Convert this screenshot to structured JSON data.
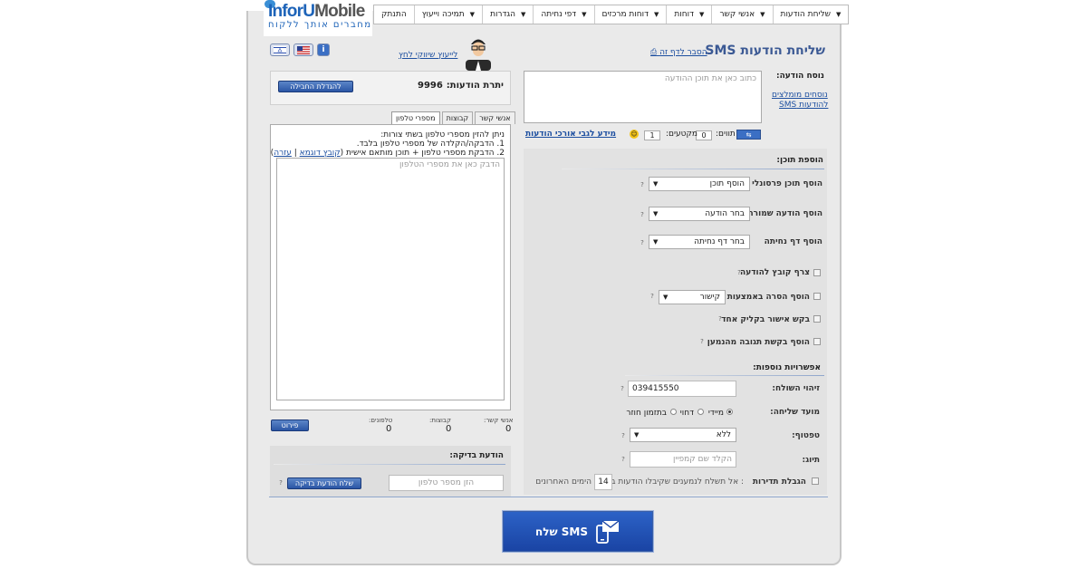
{
  "nav": [
    "שליחת הודעות",
    "אנשי קשר",
    "דוחות",
    "דוחות מרכזים",
    "דפי נחיתה",
    "הגדרות",
    "תמיכה וייעוץ",
    "התנתק"
  ],
  "logo": {
    "text_a": "InforU",
    "text_b": "Mobile",
    "tagline": "מחברים אותך ללקוח"
  },
  "header": {
    "title": "שליחת הודעות SMS",
    "help_link": "הסבר לדף זה",
    "consult_link": "לייעוץ שיווקי לחץ",
    "flag_info": "i"
  },
  "message": {
    "label": "נוסח הודעה:",
    "saved_link_1": "נוסחים מומלצים",
    "saved_link_2": "להודעות SMS",
    "placeholder": "כתוב כאן את תוכן ההודעה",
    "chars_label": "תווים:",
    "chars_value": "0",
    "segments_label": "מקטעים:",
    "segments_value": "1",
    "long_info_link": "מידע לגבי אורכי הודעות"
  },
  "content": {
    "title": "הוספת תוכן:",
    "personal_label": "הוסף תוכן פרסונלי",
    "personal_value": "הוסף תוכן",
    "saved_label": "הוסף הודעה שמורה",
    "saved_value": "בחר הודעה",
    "landing_label": "הוסף דף נחיתה",
    "landing_value": "בחר דף נחיתה",
    "attach_label": "צרף קובץ להודעה",
    "image_label": "הוסף הסרה באמצעות",
    "image_value": "קישור",
    "confirm_label": "בקש אישור בקליק אחד",
    "response_label": "הוסף בקשת תגובה מהנמען",
    "help": "?"
  },
  "options": {
    "title": "אפשרויות נוספות:",
    "sender_label": "זיהוי השולח:",
    "sender_value": "039415550",
    "time_label": "מועד שליחה:",
    "time_now": "מיידי",
    "time_later": "דחוי",
    "time_recurring": "בתזמון חוזר",
    "footer_label": "טפטוף:",
    "footer_value": "ללא",
    "tag_label": "תיוג:",
    "tag_placeholder": "הקלד שם קמפיין",
    "limit_label": "הגבלת תדירות",
    "limit_text_a": ": אל תשלח לנמענים שקיבלו הודעות ב-",
    "limit_value": "14",
    "limit_text_b": "הימים האחרונים"
  },
  "credits": {
    "label": "יתרת הודעות:",
    "value": "9996",
    "button": "להגדלת החבילה"
  },
  "tabs": [
    "אנשי קשר",
    "קבוצות",
    "מספרי טלפון"
  ],
  "phones": {
    "line1": "ניתן להזין מספרי טלפון בשתי צורות:",
    "line2": "1. הדבקה/הקלדה של מספרי טלפון בלבד.",
    "line3": "2. הדבקת מספרי טלפון + תוכן מותאם אישית (",
    "sample_link": "קובץ דוגמא",
    "help_link": "עזרה",
    "placeholder": "הדבק כאן את מספרי הטלפון",
    "contacts_label": "אנשי קשר:",
    "contacts_value": "0",
    "groups_label": "קבוצות:",
    "groups_value": "0",
    "phones_label": "טלפונים:",
    "phones_value": "0",
    "details_button": "פירוט"
  },
  "test": {
    "title": "הודעת בדיקה:",
    "placeholder": "הזן מספר טלפון",
    "button": "שלח הודעת בדיקה",
    "help": "?"
  },
  "send_button": "שלח SMS"
}
